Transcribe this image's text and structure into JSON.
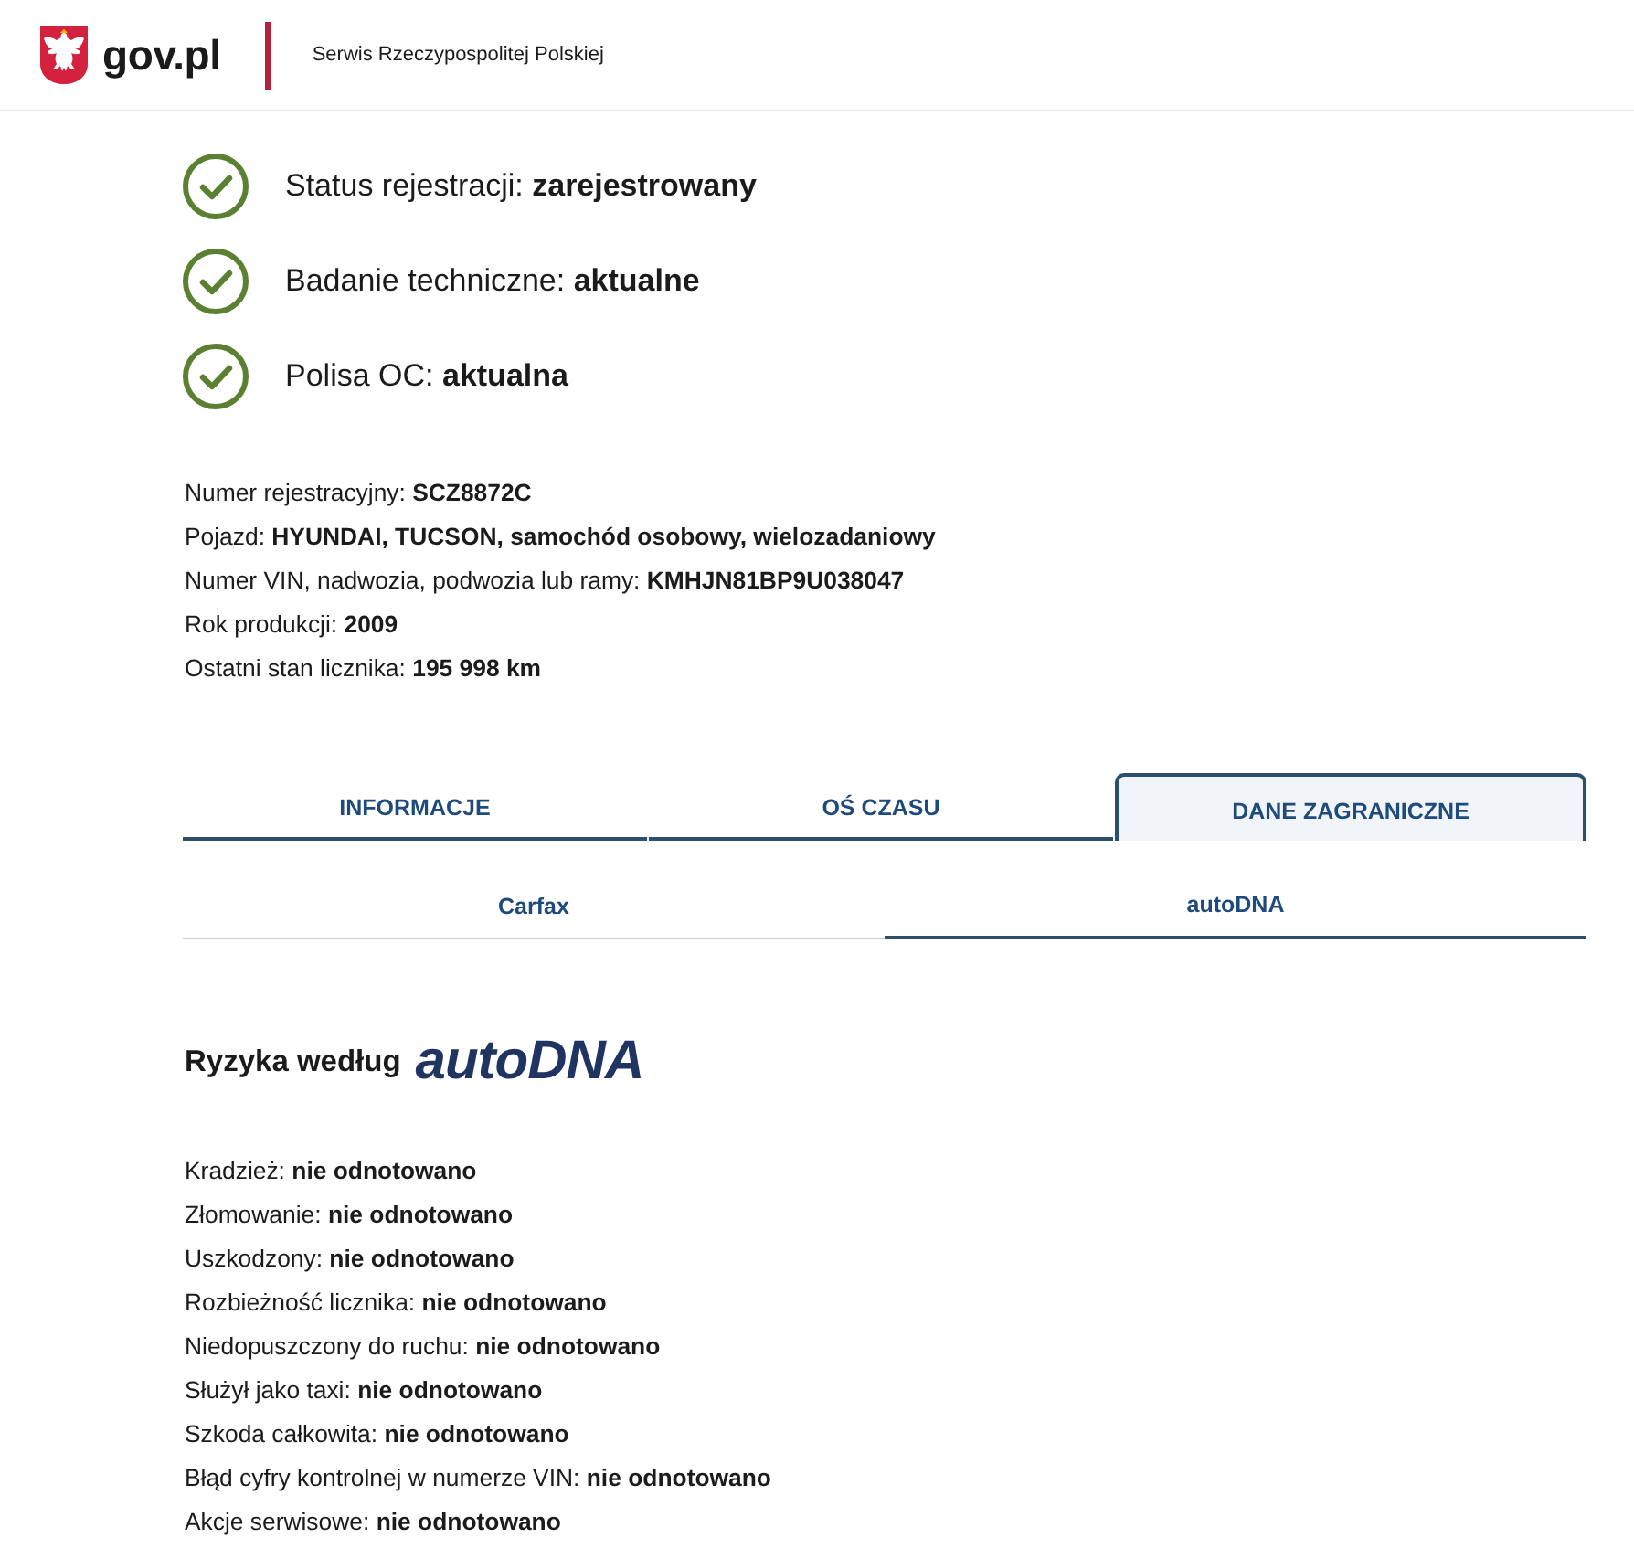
{
  "header": {
    "logo_text": "gov.pl",
    "tagline": "Serwis Rzeczypospolitej Polskiej"
  },
  "status_items": [
    {
      "text": "Status rejestracji: **zarejestrowany**",
      "ok": true
    },
    {
      "text": "Badanie techniczne: **aktualne**",
      "ok": true
    },
    {
      "text": "Polisa OC: **aktualna**",
      "ok": true
    }
  ],
  "vehicle_details": [
    "Numer rejestracyjny: **SCZ8872C**",
    "Pojazd: **HYUNDAI, TUCSON, samochód osobowy, wielozadaniowy**",
    "Numer VIN, nadwozia, podwozia lub ramy: **KMHJN81BP9U038047**",
    "Rok produkcji: **2009**",
    "Ostatni stan licznika: **195 998 km**"
  ],
  "tabs": [
    {
      "label": "INFORMACJE",
      "selected": false
    },
    {
      "label": "OŚ CZASU",
      "selected": false
    },
    {
      "label": "DANE ZAGRANICZNE",
      "selected": true
    }
  ],
  "subtabs": [
    {
      "label": "Carfax",
      "selected": false
    },
    {
      "label": "autoDNA",
      "selected": true
    }
  ],
  "risk_section": {
    "title": "Ryzyka według",
    "brand": "autoDNA",
    "items": [
      "Kradzież: **nie odnotowano**",
      "Złomowanie: **nie odnotowano**",
      "Uszkodzony: **nie odnotowano**",
      "Rozbieżność licznika: **nie odnotowano**",
      "Niedopuszczony do ruchu: **nie odnotowano**",
      "Służył jako taxi: **nie odnotowano**",
      "Szkoda całkowita: **nie odnotowano**",
      "Błąd cyfry kontrolnej w numerze VIN: **nie odnotowano**",
      "Akcje serwisowe: **nie odnotowano**"
    ]
  }
}
